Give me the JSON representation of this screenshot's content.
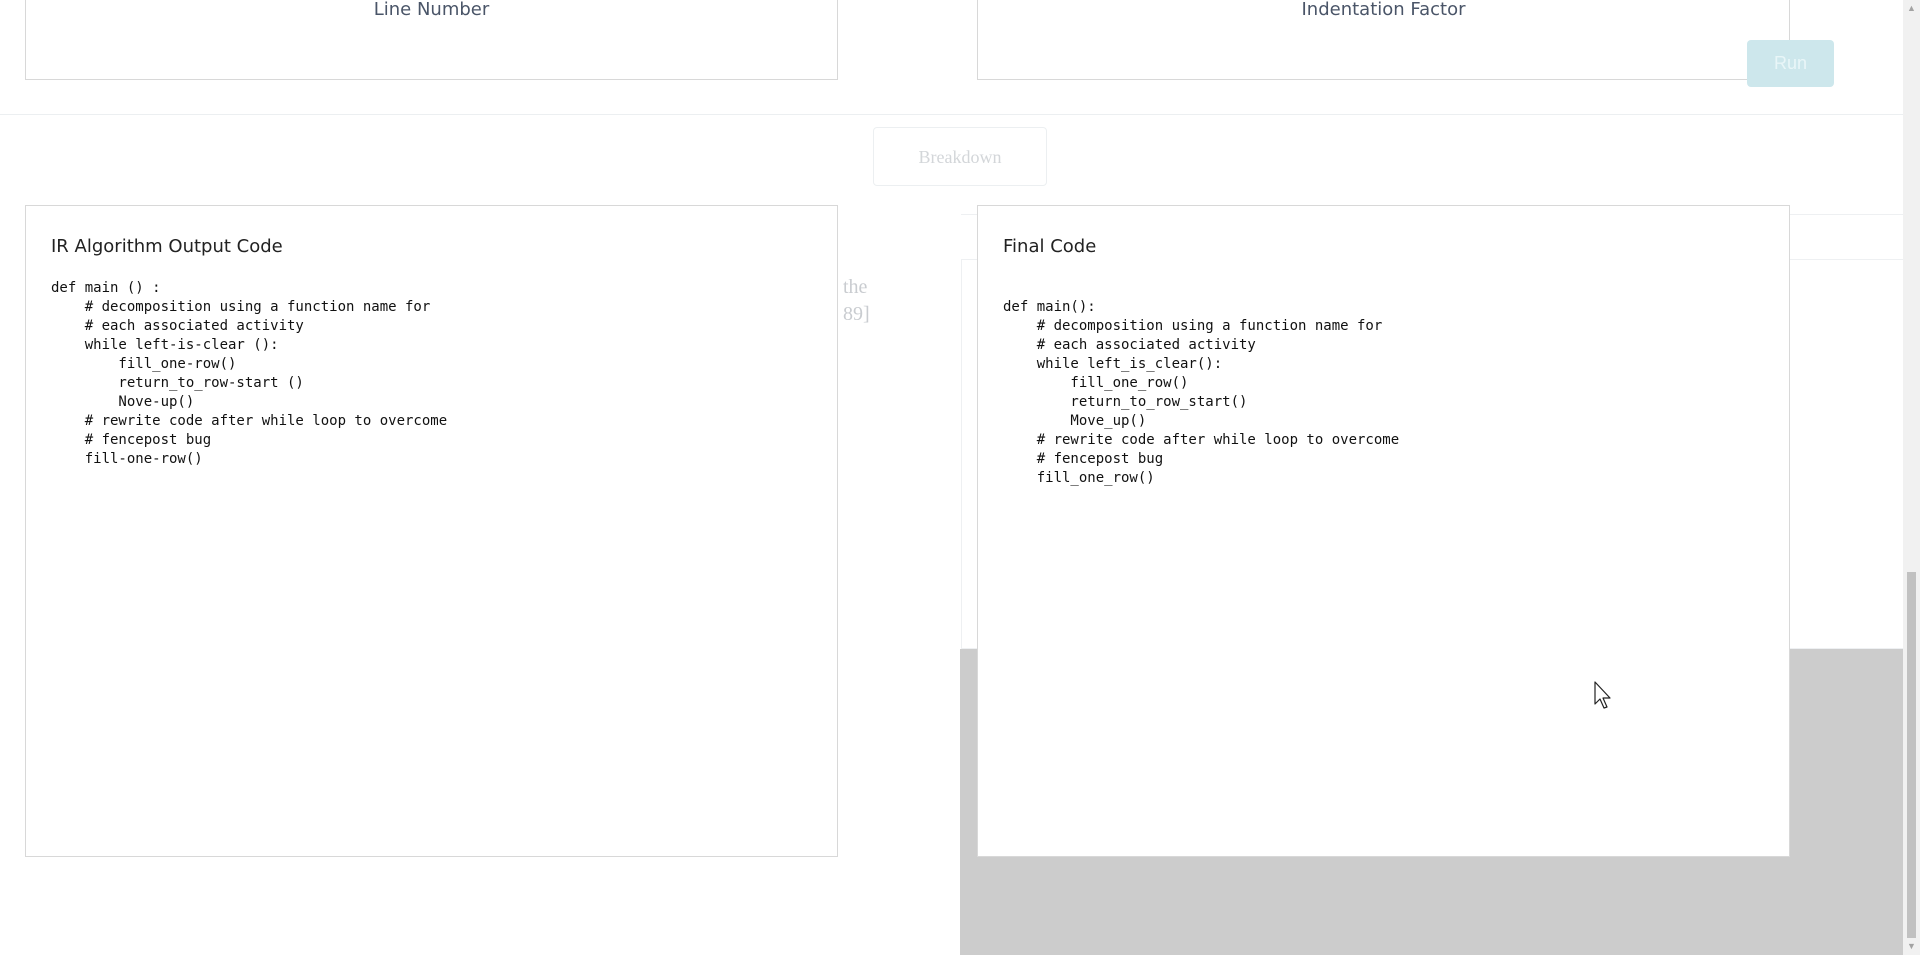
{
  "top": {
    "line_number_label": "Line Number",
    "indentation_factor_label": "Indentation Factor",
    "run_label": "Run"
  },
  "breakdown_label": "Breakdown",
  "background_text": {
    "line1": "the",
    "line2": "89]"
  },
  "ir_panel": {
    "title": "IR Algorithm Output Code",
    "code": "def main () :\n    # decomposition using a function name for\n    # each associated activity\n    while left-is-clear ():\n        fill_one-row()\n        return_to_row-start ()\n        Nove-up()\n    # rewrite code after while loop to overcome\n    # fencepost bug\n    fill-one-row()"
  },
  "final_panel": {
    "title": "Final Code",
    "code": "def main():\n    # decomposition using a function name for\n    # each associated activity\n    while left_is_clear():\n        fill_one_row()\n        return_to_row_start()\n        Move_up()\n    # rewrite code after while loop to overcome\n    # fencepost bug\n    fill_one_row()"
  },
  "icons": {
    "scroll_up": "scroll-up-arrow-icon",
    "scroll_down": "scroll-down-arrow-icon",
    "pointer": "mouse-pointer-icon"
  }
}
